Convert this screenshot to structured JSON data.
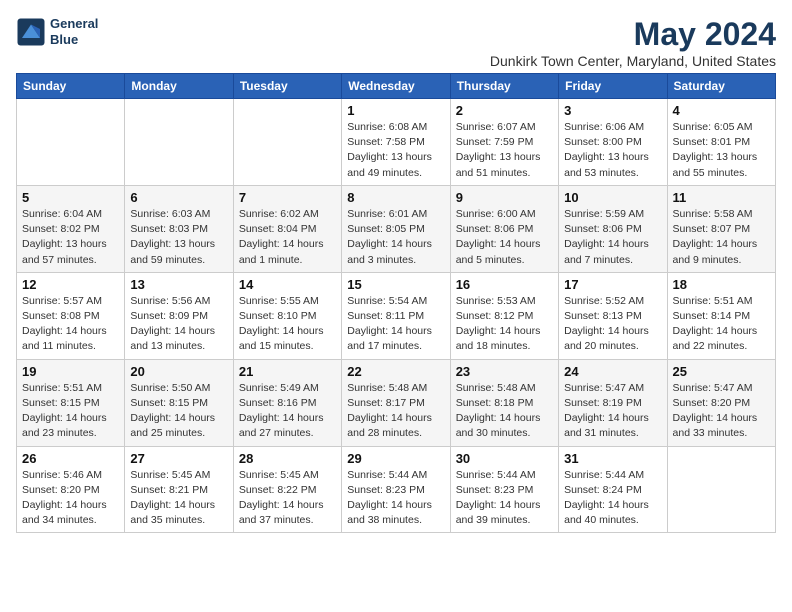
{
  "logo": {
    "line1": "General",
    "line2": "Blue"
  },
  "title": "May 2024",
  "location": "Dunkirk Town Center, Maryland, United States",
  "weekdays": [
    "Sunday",
    "Monday",
    "Tuesday",
    "Wednesday",
    "Thursday",
    "Friday",
    "Saturday"
  ],
  "weeks": [
    [
      {
        "day": "",
        "info": ""
      },
      {
        "day": "",
        "info": ""
      },
      {
        "day": "",
        "info": ""
      },
      {
        "day": "1",
        "info": "Sunrise: 6:08 AM\nSunset: 7:58 PM\nDaylight: 13 hours\nand 49 minutes."
      },
      {
        "day": "2",
        "info": "Sunrise: 6:07 AM\nSunset: 7:59 PM\nDaylight: 13 hours\nand 51 minutes."
      },
      {
        "day": "3",
        "info": "Sunrise: 6:06 AM\nSunset: 8:00 PM\nDaylight: 13 hours\nand 53 minutes."
      },
      {
        "day": "4",
        "info": "Sunrise: 6:05 AM\nSunset: 8:01 PM\nDaylight: 13 hours\nand 55 minutes."
      }
    ],
    [
      {
        "day": "5",
        "info": "Sunrise: 6:04 AM\nSunset: 8:02 PM\nDaylight: 13 hours\nand 57 minutes."
      },
      {
        "day": "6",
        "info": "Sunrise: 6:03 AM\nSunset: 8:03 PM\nDaylight: 13 hours\nand 59 minutes."
      },
      {
        "day": "7",
        "info": "Sunrise: 6:02 AM\nSunset: 8:04 PM\nDaylight: 14 hours\nand 1 minute."
      },
      {
        "day": "8",
        "info": "Sunrise: 6:01 AM\nSunset: 8:05 PM\nDaylight: 14 hours\nand 3 minutes."
      },
      {
        "day": "9",
        "info": "Sunrise: 6:00 AM\nSunset: 8:06 PM\nDaylight: 14 hours\nand 5 minutes."
      },
      {
        "day": "10",
        "info": "Sunrise: 5:59 AM\nSunset: 8:06 PM\nDaylight: 14 hours\nand 7 minutes."
      },
      {
        "day": "11",
        "info": "Sunrise: 5:58 AM\nSunset: 8:07 PM\nDaylight: 14 hours\nand 9 minutes."
      }
    ],
    [
      {
        "day": "12",
        "info": "Sunrise: 5:57 AM\nSunset: 8:08 PM\nDaylight: 14 hours\nand 11 minutes."
      },
      {
        "day": "13",
        "info": "Sunrise: 5:56 AM\nSunset: 8:09 PM\nDaylight: 14 hours\nand 13 minutes."
      },
      {
        "day": "14",
        "info": "Sunrise: 5:55 AM\nSunset: 8:10 PM\nDaylight: 14 hours\nand 15 minutes."
      },
      {
        "day": "15",
        "info": "Sunrise: 5:54 AM\nSunset: 8:11 PM\nDaylight: 14 hours\nand 17 minutes."
      },
      {
        "day": "16",
        "info": "Sunrise: 5:53 AM\nSunset: 8:12 PM\nDaylight: 14 hours\nand 18 minutes."
      },
      {
        "day": "17",
        "info": "Sunrise: 5:52 AM\nSunset: 8:13 PM\nDaylight: 14 hours\nand 20 minutes."
      },
      {
        "day": "18",
        "info": "Sunrise: 5:51 AM\nSunset: 8:14 PM\nDaylight: 14 hours\nand 22 minutes."
      }
    ],
    [
      {
        "day": "19",
        "info": "Sunrise: 5:51 AM\nSunset: 8:15 PM\nDaylight: 14 hours\nand 23 minutes."
      },
      {
        "day": "20",
        "info": "Sunrise: 5:50 AM\nSunset: 8:15 PM\nDaylight: 14 hours\nand 25 minutes."
      },
      {
        "day": "21",
        "info": "Sunrise: 5:49 AM\nSunset: 8:16 PM\nDaylight: 14 hours\nand 27 minutes."
      },
      {
        "day": "22",
        "info": "Sunrise: 5:48 AM\nSunset: 8:17 PM\nDaylight: 14 hours\nand 28 minutes."
      },
      {
        "day": "23",
        "info": "Sunrise: 5:48 AM\nSunset: 8:18 PM\nDaylight: 14 hours\nand 30 minutes."
      },
      {
        "day": "24",
        "info": "Sunrise: 5:47 AM\nSunset: 8:19 PM\nDaylight: 14 hours\nand 31 minutes."
      },
      {
        "day": "25",
        "info": "Sunrise: 5:47 AM\nSunset: 8:20 PM\nDaylight: 14 hours\nand 33 minutes."
      }
    ],
    [
      {
        "day": "26",
        "info": "Sunrise: 5:46 AM\nSunset: 8:20 PM\nDaylight: 14 hours\nand 34 minutes."
      },
      {
        "day": "27",
        "info": "Sunrise: 5:45 AM\nSunset: 8:21 PM\nDaylight: 14 hours\nand 35 minutes."
      },
      {
        "day": "28",
        "info": "Sunrise: 5:45 AM\nSunset: 8:22 PM\nDaylight: 14 hours\nand 37 minutes."
      },
      {
        "day": "29",
        "info": "Sunrise: 5:44 AM\nSunset: 8:23 PM\nDaylight: 14 hours\nand 38 minutes."
      },
      {
        "day": "30",
        "info": "Sunrise: 5:44 AM\nSunset: 8:23 PM\nDaylight: 14 hours\nand 39 minutes."
      },
      {
        "day": "31",
        "info": "Sunrise: 5:44 AM\nSunset: 8:24 PM\nDaylight: 14 hours\nand 40 minutes."
      },
      {
        "day": "",
        "info": ""
      }
    ]
  ]
}
